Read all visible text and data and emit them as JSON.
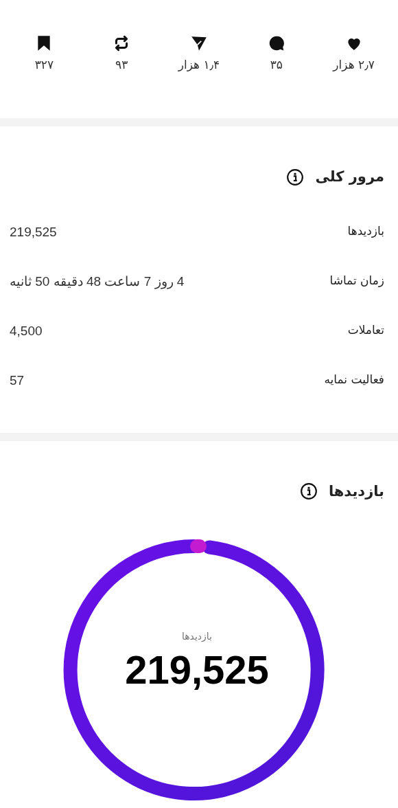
{
  "stats": [
    {
      "kind": "like",
      "count": "۲٫۷ هزار"
    },
    {
      "kind": "comment",
      "count": "۳۵"
    },
    {
      "kind": "share",
      "count": "۱٫۴ هزار"
    },
    {
      "kind": "repost",
      "count": "۹۳"
    },
    {
      "kind": "save",
      "count": "۳۲۷"
    }
  ],
  "overview": {
    "title": "مرور کلی",
    "rows": [
      {
        "label": "بازدیدها",
        "value": "219,525"
      },
      {
        "label": "زمان تماشا",
        "value": "4 روز 7 ساعت 48 دقیقه 50 ثانیه"
      },
      {
        "label": "تعاملات",
        "value": "4,500"
      },
      {
        "label": "فعالیت نمایه",
        "value": "57"
      }
    ]
  },
  "views": {
    "title": "بازدیدها",
    "ring_label": "بازدیدها",
    "ring_value": "219,525"
  }
}
